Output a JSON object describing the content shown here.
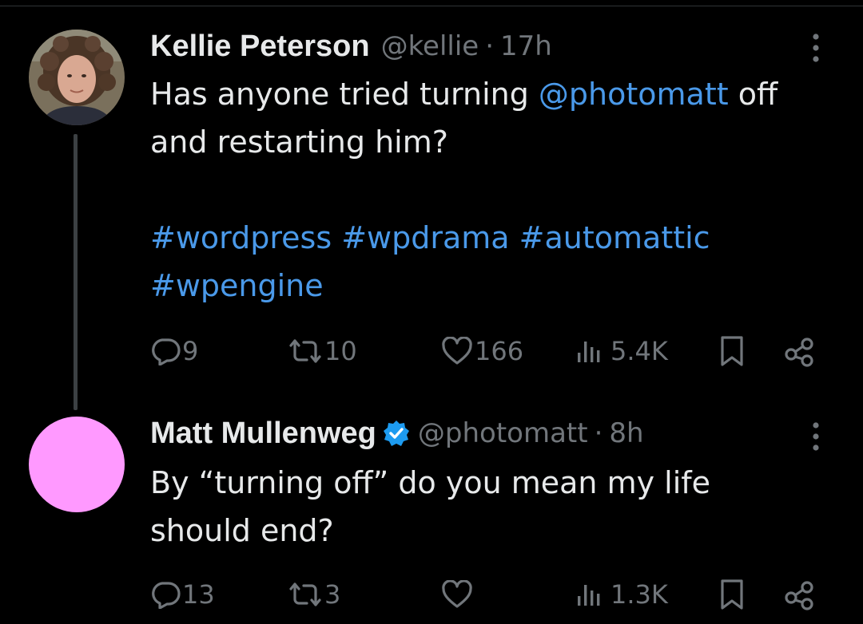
{
  "tweets": [
    {
      "author": "Kellie Peterson",
      "handle": "@kellie",
      "separator": "·",
      "time": "17h",
      "text_plain_1": "Has anyone tried turning ",
      "mention": "@photomatt",
      "text_plain_2": " off",
      "text_line_2": "and restarting him?",
      "hashtags_line_1": "#wordpress #wpdrama #automattic",
      "hashtags_line_2": "#wpengine",
      "verified": false,
      "avatar_icon": "profile-photo",
      "stats": {
        "replies": "9",
        "reposts": "10",
        "likes": "166",
        "views": "5.4K"
      }
    },
    {
      "author": "Matt Mullenweg",
      "handle": "@photomatt",
      "separator": "·",
      "time": "8h",
      "text_line_1": "By “turning off” do you mean my life",
      "text_line_2": "should end?",
      "verified": true,
      "avatar_color": "#ff99ff",
      "stats": {
        "replies": "13",
        "reposts": "3",
        "likes": "",
        "views": "1.3K"
      }
    }
  ],
  "colors": {
    "background": "#000000",
    "text": "#e7e9ea",
    "muted": "#71767b",
    "link": "#4a99e9",
    "verified_badge": "#1d9bf0",
    "thread_line": "#3c4043"
  },
  "icons": [
    "reply-icon",
    "repost-icon",
    "like-icon",
    "views-icon",
    "bookmark-icon",
    "share-icon",
    "more-icon",
    "verified-icon"
  ]
}
